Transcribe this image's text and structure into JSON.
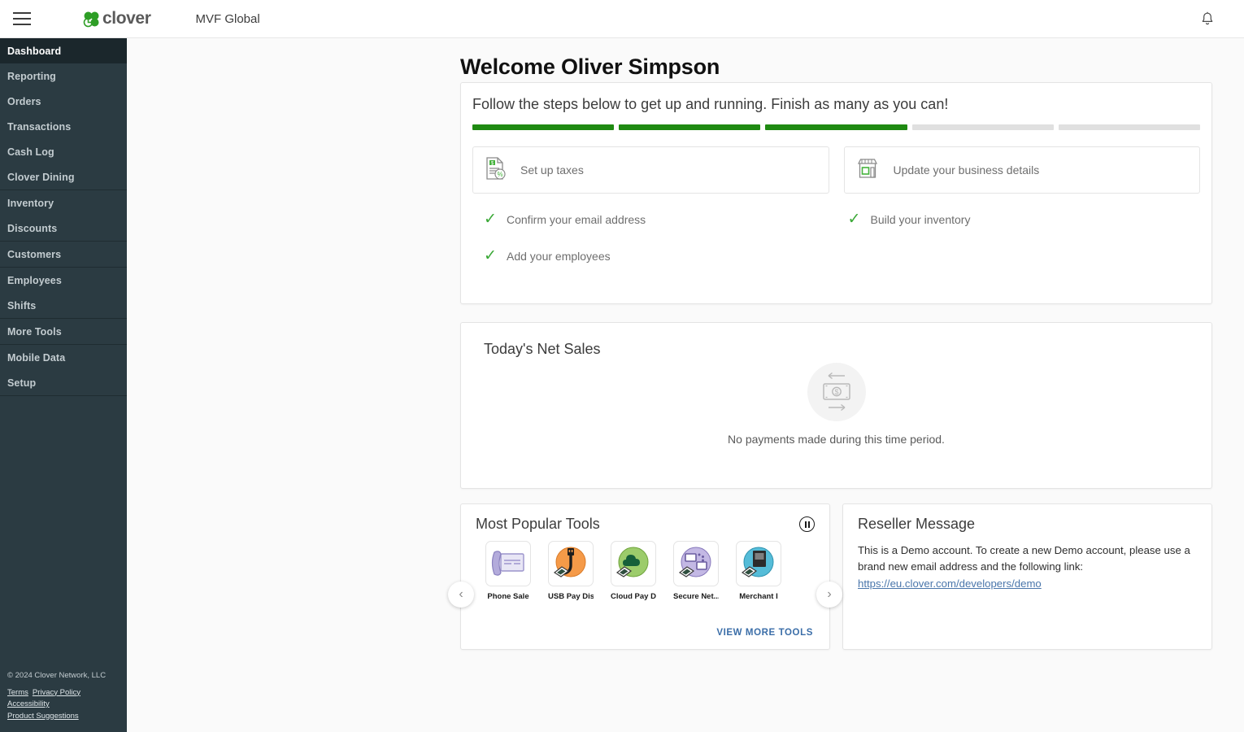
{
  "header": {
    "menu_icon": "hamburger-icon",
    "brand": "clover",
    "merchant": "MVF Global",
    "notification_icon": "bell-icon"
  },
  "sidebar": {
    "groups": [
      {
        "items": [
          {
            "label": "Dashboard",
            "active": true
          },
          {
            "label": "Reporting",
            "active": false
          },
          {
            "label": "Orders",
            "active": false
          },
          {
            "label": "Transactions",
            "active": false
          },
          {
            "label": "Cash Log",
            "active": false
          },
          {
            "label": "Clover Dining",
            "active": false
          }
        ]
      },
      {
        "items": [
          {
            "label": "Inventory",
            "active": false
          },
          {
            "label": "Discounts",
            "active": false
          }
        ]
      },
      {
        "items": [
          {
            "label": "Customers",
            "active": false
          }
        ]
      },
      {
        "items": [
          {
            "label": "Employees",
            "active": false
          },
          {
            "label": "Shifts",
            "active": false
          }
        ]
      },
      {
        "items": [
          {
            "label": "More Tools",
            "active": false
          }
        ]
      },
      {
        "items": [
          {
            "label": "Mobile Data",
            "active": false
          },
          {
            "label": "Setup",
            "active": false
          }
        ]
      }
    ],
    "footer": {
      "copyright": "© 2024 Clover Network, LLC",
      "links": [
        "Terms",
        "Privacy Policy",
        "Accessibility",
        "Product Suggestions"
      ]
    }
  },
  "main": {
    "page_title": "Welcome Oliver Simpson",
    "onboarding": {
      "heading": "Follow the steps below to get up and running. Finish as many as you can!",
      "progress": {
        "total": 5,
        "completed": 3,
        "fill_color": "#1f8a12",
        "track_color": "#e0e0e0"
      },
      "pending_tasks": [
        {
          "label": "Set up taxes",
          "icon": "tax-receipt-icon"
        },
        {
          "label": "Update your business details",
          "icon": "storefront-icon"
        }
      ],
      "completed_tasks": [
        {
          "label": "Confirm your email address",
          "icon": "check-icon"
        },
        {
          "label": "Build your inventory",
          "icon": "check-icon"
        },
        {
          "label": "Add your employees",
          "icon": "check-icon"
        }
      ]
    },
    "net_sales": {
      "title": "Today's Net Sales",
      "empty_icon": "money-transfer-icon",
      "empty_message": "No payments made during this time period."
    },
    "tools": {
      "title": "Most Popular Tools",
      "pause_icon": "pause-icon",
      "prev_icon": "chevron-left-icon",
      "next_icon": "chevron-right-icon",
      "view_more_label": "VIEW MORE TOOLS",
      "items": [
        {
          "name": "Phone Sale",
          "icon": "phone-card-icon",
          "color": "#a9a2d4"
        },
        {
          "name": "USB Pay Dis...",
          "icon": "usb-cable-icon",
          "color": "#f0913f"
        },
        {
          "name": "Cloud Pay D...",
          "icon": "cloud-icon",
          "color": "#8cc152"
        },
        {
          "name": "Secure Net...",
          "icon": "network-icon",
          "color": "#9b8cc8"
        },
        {
          "name": "Merchant I",
          "icon": "device-icon",
          "color": "#4ab3d1"
        }
      ]
    },
    "reseller": {
      "title": "Reseller Message",
      "body": "This is a Demo account. To create a new Demo account, please use a brand new email address and the following link:",
      "link": "https://eu.clover.com/developers/demo"
    }
  }
}
